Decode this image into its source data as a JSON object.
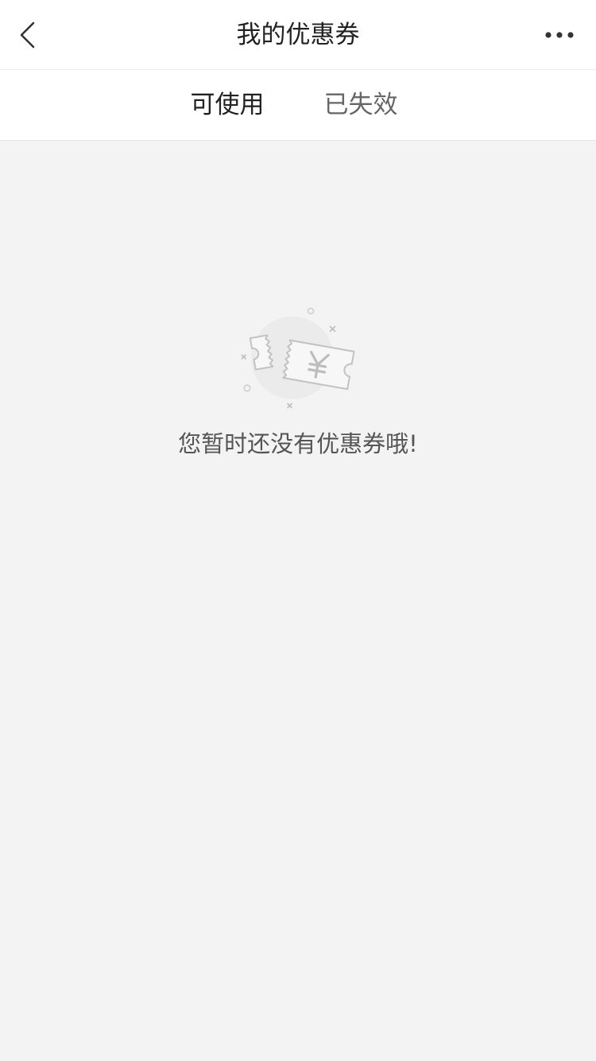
{
  "header": {
    "title": "我的优惠券",
    "back_icon": "chevron-left-icon",
    "more_icon": "more-dots-icon"
  },
  "tabs": [
    {
      "label": "可使用",
      "active": true
    },
    {
      "label": "已失效",
      "active": false
    }
  ],
  "empty_state": {
    "icon": "coupon-icon",
    "message": "您暂时还没有优惠券哦!"
  },
  "colors": {
    "background": "#f3f3f3",
    "bar": "#ffffff",
    "text_primary": "#222222",
    "text_secondary": "#666666",
    "icon_stroke": "#c0c0c0"
  }
}
